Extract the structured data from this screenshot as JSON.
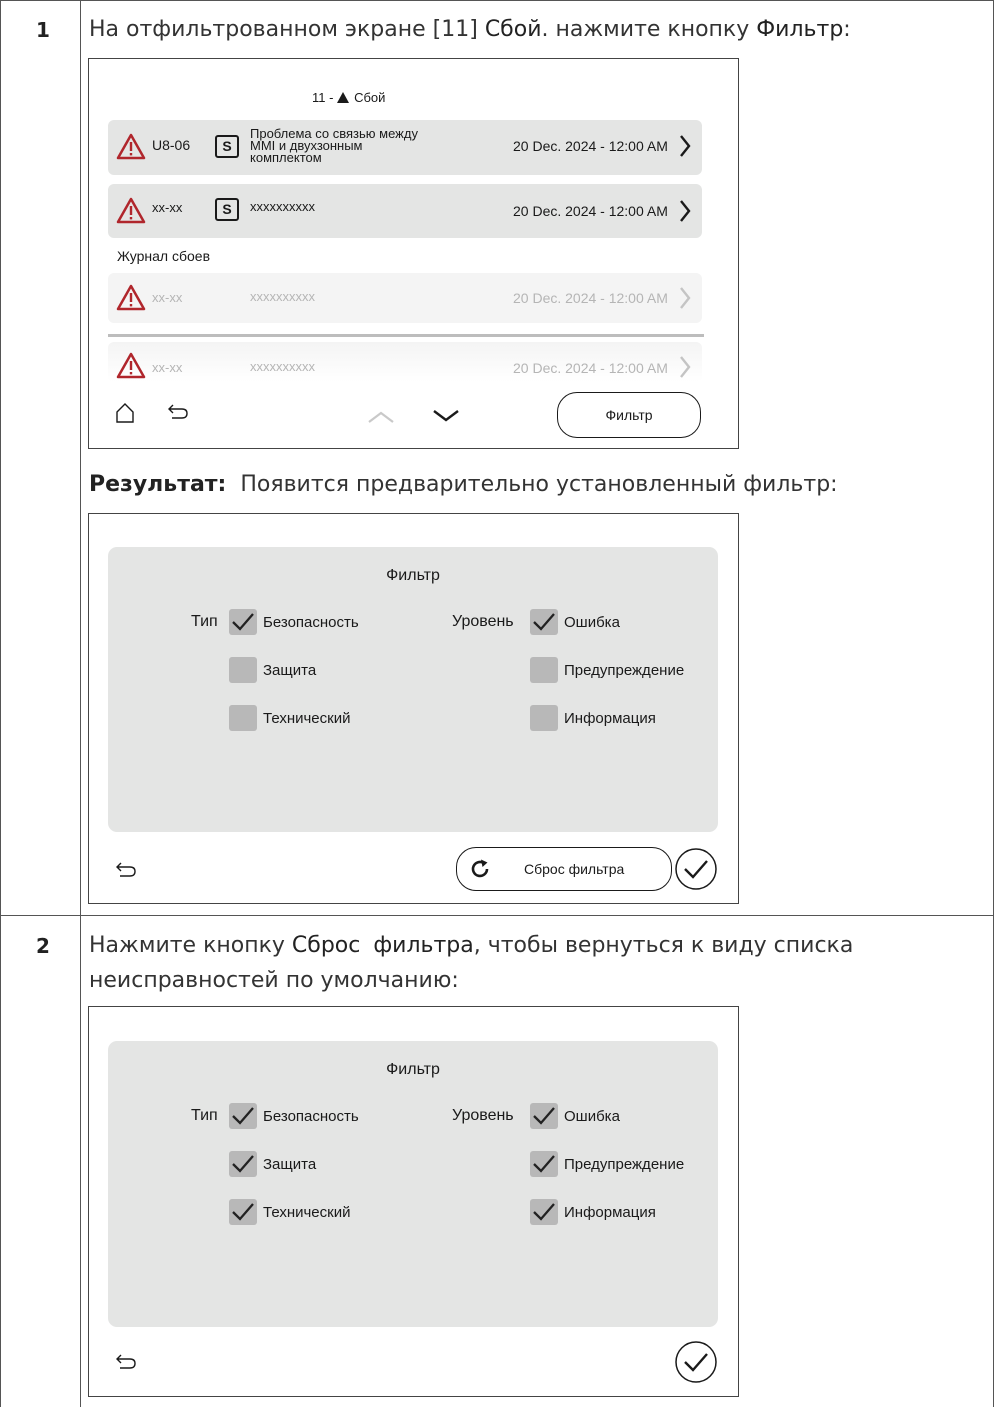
{
  "step1": {
    "number": "1",
    "instruction": [
      "На отфильтрованном экране [11] ",
      "Сбой",
      ". нажмите кнопку ",
      "Фильтр",
      ":"
    ],
    "screen": {
      "title_prefix": "11 - ",
      "title_text": "Сбой",
      "active_errors": [
        {
          "code": "U8-06",
          "desc_lines": [
            "Проблема со связью между",
            "MMI и двухзонным",
            "комплектом"
          ],
          "date": "20 Dec. 2024 - 12:00 AM",
          "badge": "S"
        },
        {
          "code": "xx-xx",
          "desc_lines": [
            "xxxxxxxxxx"
          ],
          "date": "20 Dec. 2024 - 12:00 AM",
          "badge": "S"
        }
      ],
      "history_label": "Журнал сбоев",
      "history_errors": [
        {
          "code": "xx-xx",
          "desc": "xxxxxxxxxx",
          "date": "20 Dec. 2024 - 12:00 AM"
        },
        {
          "code": "xx-xx",
          "desc": "xxxxxxxxxx",
          "date": "20 Dec. 2024 - 12:00 AM"
        }
      ],
      "filter_button": "Фильтр"
    },
    "result_label": "Результат:",
    "result_text": "Появится предварительно установленный фильтр:",
    "filter_screen": {
      "title": "Фильтр",
      "type_label": "Тип",
      "level_label": "Уровень",
      "types": [
        {
          "label": "Безопасность",
          "checked": true
        },
        {
          "label": "Защита",
          "checked": false
        },
        {
          "label": "Технический",
          "checked": false
        }
      ],
      "levels": [
        {
          "label": "Ошибка",
          "checked": true
        },
        {
          "label": "Предупреждение",
          "checked": false
        },
        {
          "label": "Информация",
          "checked": false
        }
      ],
      "reset_button": "Сброс фильтра"
    }
  },
  "step2": {
    "number": "2",
    "instruction_line1": [
      "Нажмите кнопку ",
      "Сброс фильтра",
      ", чтобы вернуться к виду списка"
    ],
    "instruction_line2": "неисправностей по умолчанию:",
    "filter_screen": {
      "title": "Фильтр",
      "type_label": "Тип",
      "level_label": "Уровень",
      "types": [
        {
          "label": "Безопасность",
          "checked": true
        },
        {
          "label": "Защита",
          "checked": true
        },
        {
          "label": "Технический",
          "checked": true
        }
      ],
      "levels": [
        {
          "label": "Ошибка",
          "checked": true
        },
        {
          "label": "Предупреждение",
          "checked": true
        },
        {
          "label": "Информация",
          "checked": true
        }
      ]
    }
  },
  "colors": {
    "warning_red": "#b0262c",
    "row_bg": "#e4e5e4",
    "checkbox_bg": "#b8b8b8"
  }
}
